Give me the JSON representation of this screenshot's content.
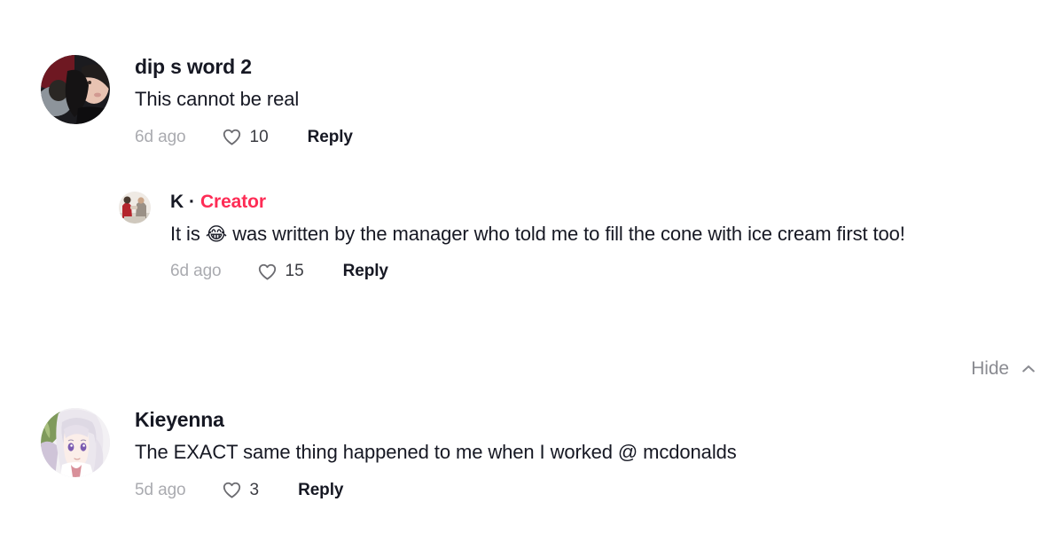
{
  "theme": {
    "background": "#ffffff",
    "text_primary": "#161823",
    "text_muted": "#aaabb0",
    "accent_creator": "#fe2c55",
    "icon_gray": "#6b6b70"
  },
  "comments": [
    {
      "id": "comment-1",
      "username": "dip s word 2",
      "text": "This cannot be real",
      "timestamp": "6d ago",
      "like_count": "10",
      "reply_label": "Reply",
      "avatar_name": "avatar-dip-s-word-2",
      "is_creator": false
    },
    {
      "id": "comment-1-reply",
      "username": "K",
      "separator": "·",
      "creator_badge": "Creator",
      "text_before_emoji": "It is ",
      "emoji": "😂",
      "text_after_emoji": " was written by the manager who told me to fill the cone with ice cream first too!",
      "timestamp": "6d ago",
      "like_count": "15",
      "reply_label": "Reply",
      "avatar_name": "avatar-k-creator",
      "is_creator": true
    },
    {
      "id": "comment-2",
      "username": "Kieyenna",
      "text": "The EXACT same thing happened to me when I worked @ mcdonalds",
      "timestamp": "5d ago",
      "like_count": "3",
      "reply_label": "Reply",
      "avatar_name": "avatar-kieyenna",
      "is_creator": false
    }
  ],
  "hide_control": {
    "label": "Hide",
    "icon": "chevron-up-icon"
  },
  "icons": {
    "heart": "heart-outline-icon",
    "chevron_up": "chevron-up-icon"
  }
}
